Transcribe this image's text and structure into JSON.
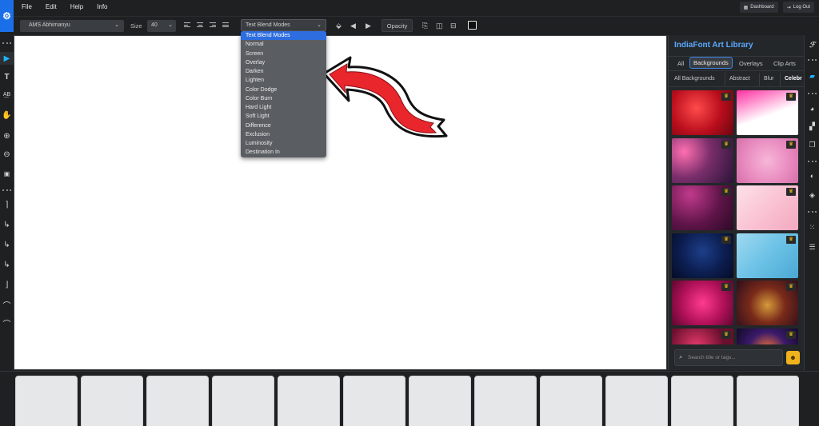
{
  "menubar": {
    "logo": "⚙",
    "items": [
      "File",
      "Edit",
      "Help",
      "Info"
    ],
    "dashboard_label": "Dashboard",
    "logout_label": "Log Out"
  },
  "toolbar": {
    "font_family": "AMS Abhimanyu",
    "size_label": "Size",
    "size_value": "40",
    "blend_select_label": "Text Blend Modes",
    "opacity_label": "Opacity"
  },
  "blend_modes": [
    "Text Blend Modes",
    "Normal",
    "Screen",
    "Overlay",
    "Darken",
    "Lighten",
    "Color Dodge",
    "Color Burn",
    "Hard Light",
    "Soft Light",
    "Difference",
    "Exclusion",
    "Luminosity",
    "Destination In"
  ],
  "blend_selected": "Text Blend Modes",
  "library": {
    "title": "IndiaFont Art Library",
    "tabs": [
      "All",
      "Backgrounds",
      "Overlays",
      "Clip Arts"
    ],
    "active_tab": "Backgrounds",
    "categories": [
      "All Backgrounds",
      "Abstract",
      "Blur",
      "Celebr"
    ],
    "search_placeholder": "Search title or tags...",
    "crown_glyph": "♛",
    "thumbnails": [
      {
        "bg": "radial-gradient(circle at 40% 40%, #ff4b4b, #b80d1c 55%, #6a0711)"
      },
      {
        "bg": "linear-gradient(160deg, #ff2fa0 0%, #ff8dcc 25%, #ffffff 55%, #ffffff 100%)"
      },
      {
        "bg": "radial-gradient(circle at 20% 30%, #ff6fb1, #7a2e6b 45%, #2a1438)"
      },
      {
        "bg": "radial-gradient(circle at 50% 50%, #f7b6d8, #e88abf 60%, #d370a8)"
      },
      {
        "bg": "radial-gradient(circle at 30% 20%, #c03a8c, #5e1448 55%, #2b0a26)"
      },
      {
        "bg": "linear-gradient(135deg, #fde2ea, #f9bdd0 60%, #f1a9c0)"
      },
      {
        "bg": "radial-gradient(circle at 50% 40%, #1d3f8a, #0c1d4f 55%, #050c25)"
      },
      {
        "bg": "linear-gradient(135deg, #9fd9f0, #6cc2e6 50%, #4aa8d3)"
      },
      {
        "bg": "radial-gradient(circle at 50% 50%, #ff3b8f, #b2115a 55%, #5c072e)"
      },
      {
        "bg": "radial-gradient(circle at 50% 55%, #d49a3a, #7a2a1a 45%, #2c0e1a)"
      },
      {
        "bg": "radial-gradient(circle at 40% 40%, #e53a6a, #6b0f2f 60%)"
      },
      {
        "bg": "radial-gradient(circle at 50% 50%, #ff7a30, #3a1a6a 50%, #120a28)"
      }
    ]
  },
  "colors": {
    "accent": "#1a6fe8",
    "library_title": "#5aa8ff",
    "dropdown_selected": "#2d6de0",
    "crown": "#f5c01c",
    "arrow_red": "#e8262c"
  },
  "page_count": 12
}
